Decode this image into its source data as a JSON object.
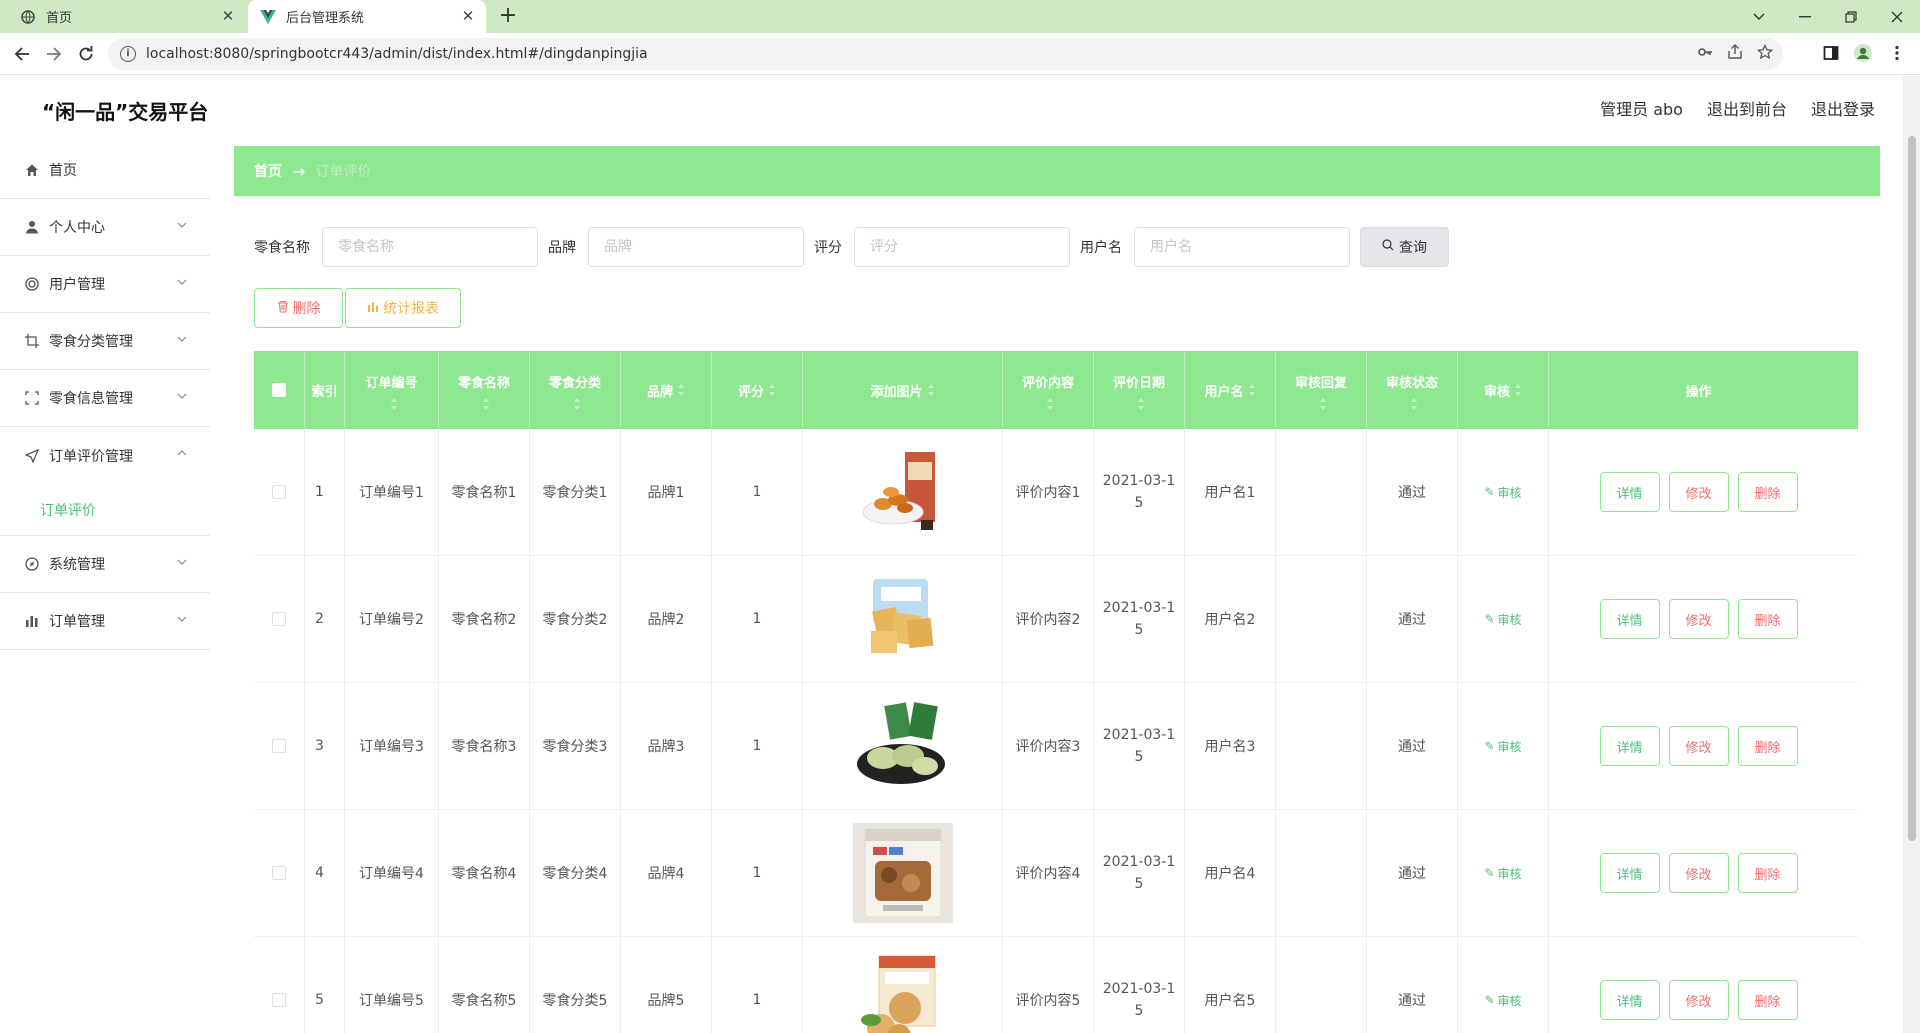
{
  "browser": {
    "tabs": [
      {
        "title": "首页",
        "active": false
      },
      {
        "title": "后台管理系统",
        "active": true
      }
    ],
    "url": "localhost:8080/springbootcr443/admin/dist/index.html#/dingdanpingjia"
  },
  "header": {
    "title": "“闲一品”交易平台",
    "admin": "管理员 abo",
    "to_front": "退出到前台",
    "logout": "退出登录"
  },
  "sidebar": {
    "items": [
      {
        "label": "首页",
        "icon": "home-icon"
      },
      {
        "label": "个人中心",
        "icon": "user-icon"
      },
      {
        "label": "用户管理",
        "icon": "users-icon"
      },
      {
        "label": "零食分类管理",
        "icon": "crop-icon"
      },
      {
        "label": "零食信息管理",
        "icon": "frame-icon"
      },
      {
        "label": "订单评价管理",
        "icon": "send-icon",
        "open": true,
        "sub": "订单评价"
      },
      {
        "label": "系统管理",
        "icon": "compass-icon"
      },
      {
        "label": "订单管理",
        "icon": "chart-icon"
      }
    ]
  },
  "breadcrumb": {
    "home": "首页",
    "separator": "→",
    "current": "订单评价"
  },
  "search": {
    "fields": [
      {
        "label": "零食名称",
        "placeholder": "零食名称"
      },
      {
        "label": "品牌",
        "placeholder": "品牌"
      },
      {
        "label": "评分",
        "placeholder": "评分"
      },
      {
        "label": "用户名",
        "placeholder": "用户名"
      }
    ],
    "query_label": "查询"
  },
  "actions": {
    "delete_label": "删除",
    "stats_label": "统计报表"
  },
  "table": {
    "headers": [
      "",
      "索引",
      "订单编号",
      "零食名称",
      "零食分类",
      "品牌",
      "评分",
      "添加图片",
      "评价内容",
      "评价日期",
      "用户名",
      "审核回复",
      "审核状态",
      "审核",
      "操作"
    ],
    "rows": [
      {
        "index": "1",
        "order_no": "订单编号1",
        "name": "零食名称1",
        "category": "零食分类1",
        "brand": "品牌1",
        "score": "1",
        "content": "评价内容1",
        "date": "2021-03-15",
        "user": "用户名1",
        "reply": "",
        "status": "通过"
      },
      {
        "index": "2",
        "order_no": "订单编号2",
        "name": "零食名称2",
        "category": "零食分类2",
        "brand": "品牌2",
        "score": "1",
        "content": "评价内容2",
        "date": "2021-03-15",
        "user": "用户名2",
        "reply": "",
        "status": "通过"
      },
      {
        "index": "3",
        "order_no": "订单编号3",
        "name": "零食名称3",
        "category": "零食分类3",
        "brand": "品牌3",
        "score": "1",
        "content": "评价内容3",
        "date": "2021-03-15",
        "user": "用户名3",
        "reply": "",
        "status": "通过"
      },
      {
        "index": "4",
        "order_no": "订单编号4",
        "name": "零食名称4",
        "category": "零食分类4",
        "brand": "品牌4",
        "score": "1",
        "content": "评价内容4",
        "date": "2021-03-15",
        "user": "用户名4",
        "reply": "",
        "status": "通过"
      },
      {
        "index": "5",
        "order_no": "订单编号5",
        "name": "零食名称5",
        "category": "零食分类5",
        "brand": "品牌5",
        "score": "1",
        "content": "评价内容5",
        "date": "2021-03-15",
        "user": "用户名5",
        "reply": "",
        "status": "通过"
      }
    ],
    "audit_label": "审核",
    "op_labels": {
      "detail": "详情",
      "edit": "修改",
      "delete": "删除"
    }
  },
  "colors": {
    "accent": "#8de88f",
    "link_green": "#4cc27e",
    "danger": "#f56c6c",
    "warning": "#f5b342"
  }
}
